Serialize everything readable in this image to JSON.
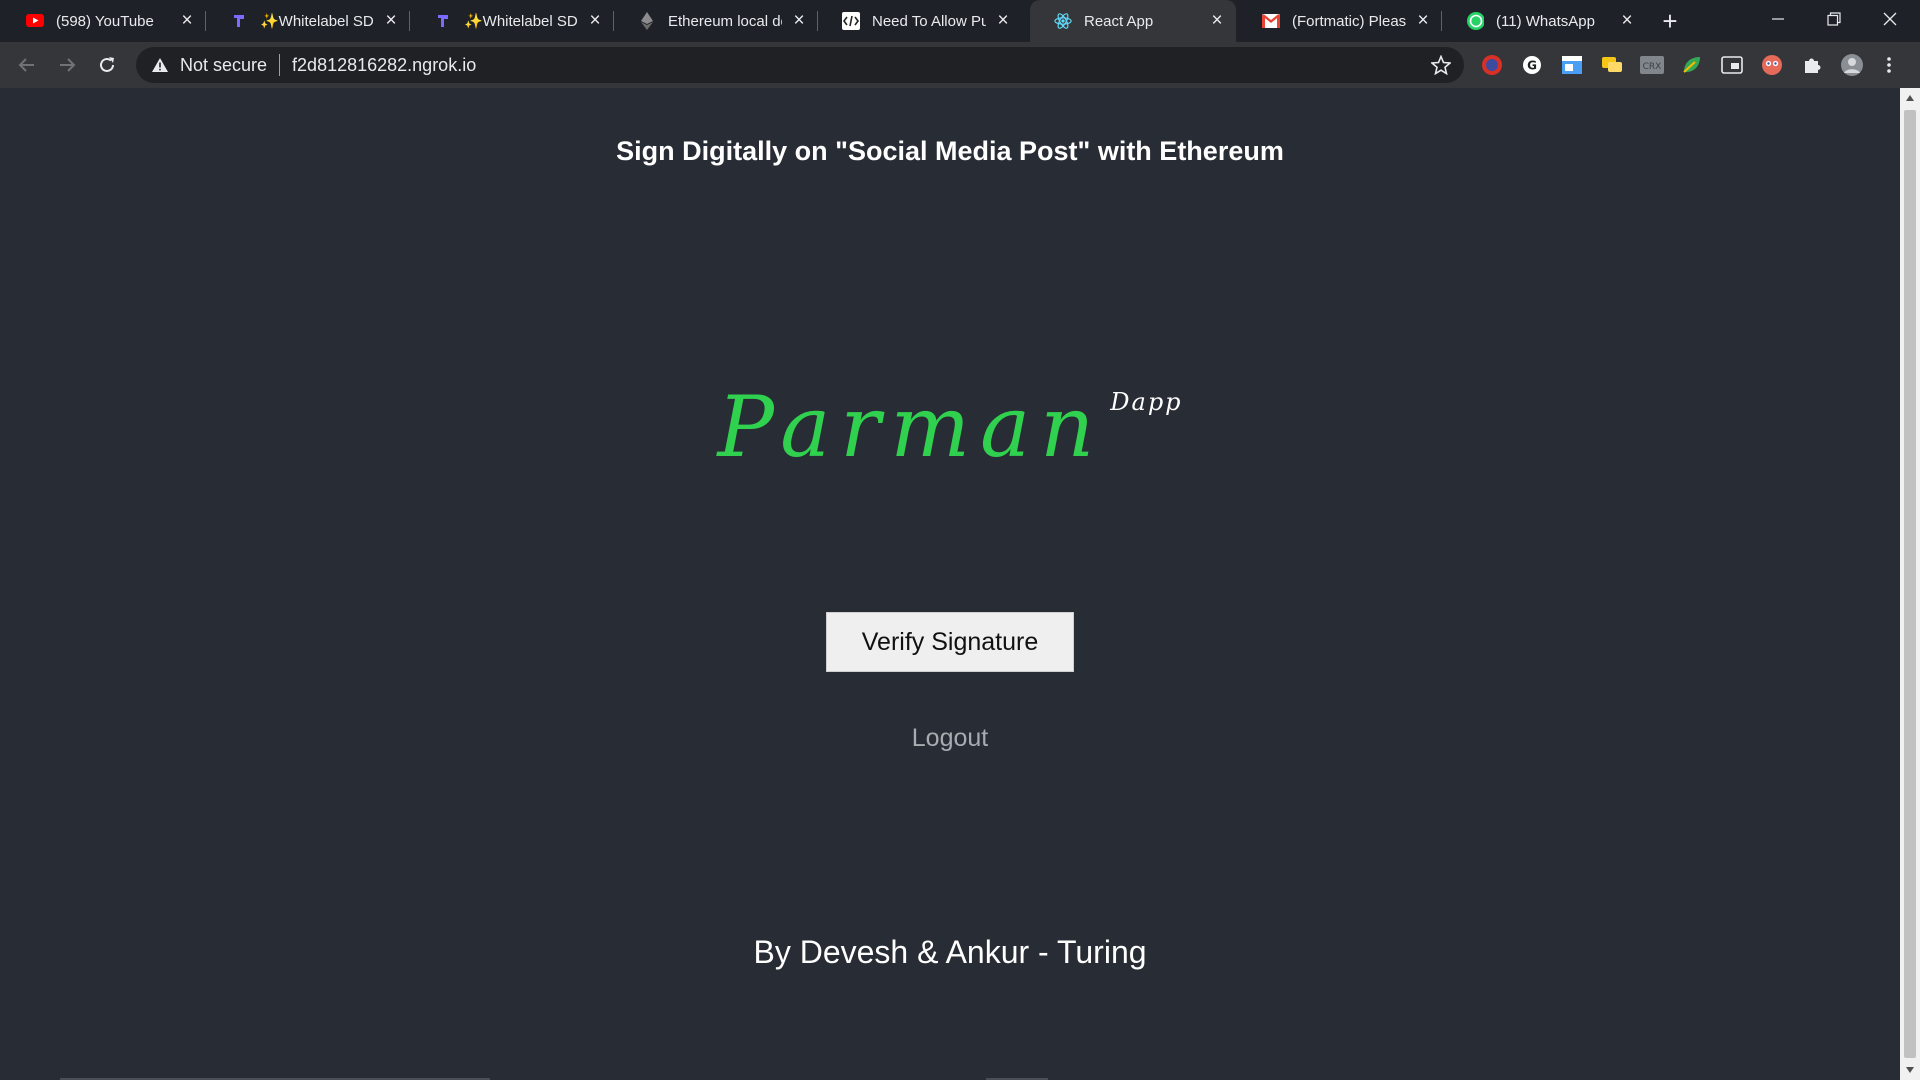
{
  "browser": {
    "tabs": [
      {
        "title": "(598) YouTube",
        "icon": "youtube-icon",
        "color": "#ff0000"
      },
      {
        "title": "✨Whitelabel SDK",
        "icon": "magic-link-icon",
        "color": "#6851ff"
      },
      {
        "title": "✨Whitelabel SDK",
        "icon": "magic-link-icon",
        "color": "#6851ff"
      },
      {
        "title": "Ethereum local de",
        "icon": "ethereum-icon",
        "color": "#9aa0a6"
      },
      {
        "title": "Need To Allow Pu",
        "icon": "code-icon",
        "color": "#ffffff"
      },
      {
        "title": "React App",
        "icon": "react-icon",
        "color": "#61dafb"
      },
      {
        "title": "(Fortmatic) Please",
        "icon": "gmail-icon",
        "color": "#ea4335"
      },
      {
        "title": "(11) WhatsApp",
        "icon": "whatsapp-icon",
        "color": "#25d366"
      }
    ],
    "active_tab_index": 5,
    "address": {
      "security_label": "Not secure",
      "url": "f2d812816282.ngrok.io"
    }
  },
  "page": {
    "heading": "Sign Digitally on \"Social Media Post\" with Ethereum",
    "logo_main": "Parman",
    "logo_sup": "Dapp",
    "verify_button": "Verify Signature",
    "logout": "Logout",
    "footer": "By Devesh & Ankur - Turing"
  },
  "colors": {
    "background": "#282c34",
    "logo_green": "#2fd14f",
    "tab_active": "#35363a"
  }
}
